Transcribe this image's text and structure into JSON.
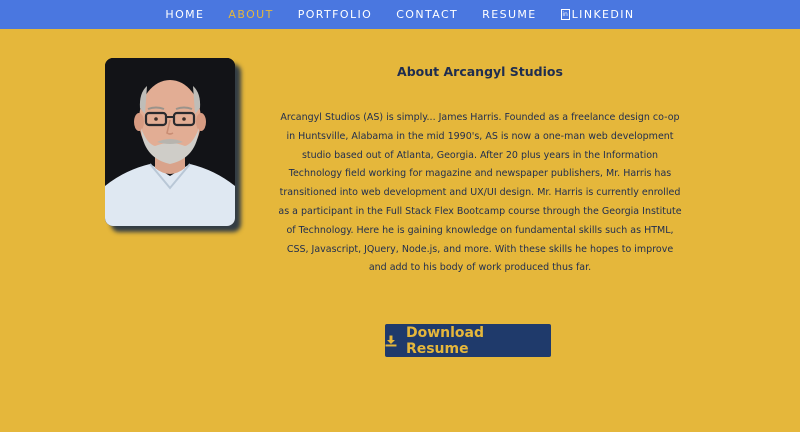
{
  "nav": {
    "items": [
      {
        "label": "HOME",
        "active": false
      },
      {
        "label": "ABOUT",
        "active": true
      },
      {
        "label": "PORTFOLIO",
        "active": false
      },
      {
        "label": "CONTACT",
        "active": false
      },
      {
        "label": "RESUME",
        "active": false
      },
      {
        "label": "LINKEDIN",
        "active": false,
        "icon": "linkedin-icon"
      }
    ]
  },
  "about": {
    "title": "About Arcangyl Studios",
    "text": "Arcangyl Studios (AS) is simply... James Harris. Founded as a freelance design co-op in Huntsville, Alabama in the mid 1990's, AS is now a one-man web development studio based out of Atlanta, Georgia. After 20 plus years in the Information Technology field working for magazine and newspaper publishers, Mr. Harris has transitioned into web development and UX/UI design. Mr. Harris is currently enrolled as a participant in the Full Stack Flex Bootcamp course through the Georgia Institute of Technology. Here he is gaining knowledge on fundamental skills such as HTML, CSS, Javascript, JQuery, Node.js, and more. With these skills he hopes to improve and add to his body of work produced thus far."
  },
  "download": {
    "label": "Download Resume",
    "icon": "download-icon"
  },
  "colors": {
    "background": "#e5b73b",
    "navbar": "#4a77e0",
    "button": "#1f3a6b",
    "text": "#1f2d4f"
  }
}
